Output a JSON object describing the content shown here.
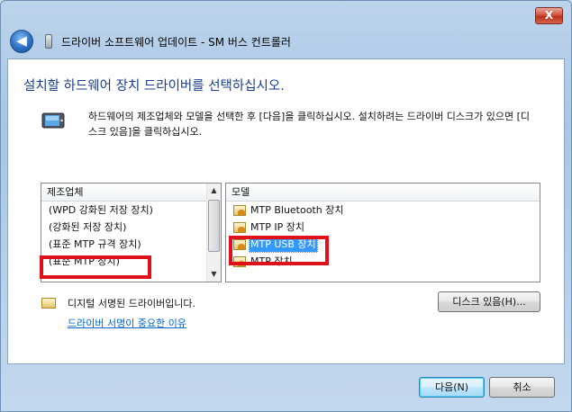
{
  "window": {
    "close_label": "X",
    "back_label": "◀",
    "title": "드라이버 소프트웨어 업데이트 - SM 버스 컨트롤러"
  },
  "main": {
    "heading": "설치할 하드웨어 장치 드라이버를 선택하십시오.",
    "description": "하드웨어의 제조업체와 모델을 선택한 후 [다음]을 클릭하십시오. 설치하려는 드라이버 디스크가 있으면 [디스크 있음]을 클릭하십시오."
  },
  "manufacturers": {
    "header": "제조업체",
    "items": [
      "(WPD 강화된 저장 장치)",
      "(강화된 저장 장치)",
      "(표준 MTP 규격 장치)",
      "(표준 MTP 장치)"
    ],
    "selected": "(표준 MTP 장치)"
  },
  "models": {
    "header": "모델",
    "items": [
      "MTP Bluetooth 장치",
      "MTP IP 장치",
      "MTP USB 장치",
      "MTP 장치"
    ],
    "selected": "MTP USB 장치"
  },
  "signature": {
    "status": "디지털 서명된 드라이버입니다.",
    "link": "드라이버 서명이 중요한 이유"
  },
  "buttons": {
    "have_disk": "디스크 있음(H)...",
    "next": "다음(N)",
    "cancel": "취소"
  },
  "colors": {
    "highlight_box": "#e0101a",
    "selection": "#3399ff",
    "heading": "#1a3e8c",
    "link": "#0066cc"
  }
}
